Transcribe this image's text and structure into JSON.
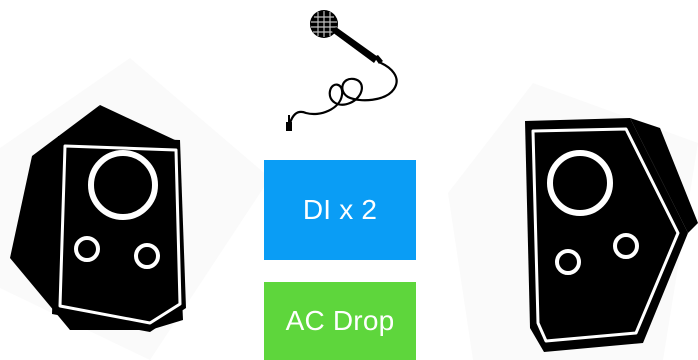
{
  "colors": {
    "background": "#ffffff",
    "speaker": "#000000",
    "di_box": "#0a9df5",
    "ac_box": "#5ed63c",
    "box_text": "#ffffff"
  },
  "icons": {
    "left_speaker": "speaker-icon",
    "right_speaker": "speaker-icon",
    "microphone": "microphone-icon"
  },
  "boxes": {
    "di_label": "DI x 2",
    "ac_label": "AC Drop"
  }
}
